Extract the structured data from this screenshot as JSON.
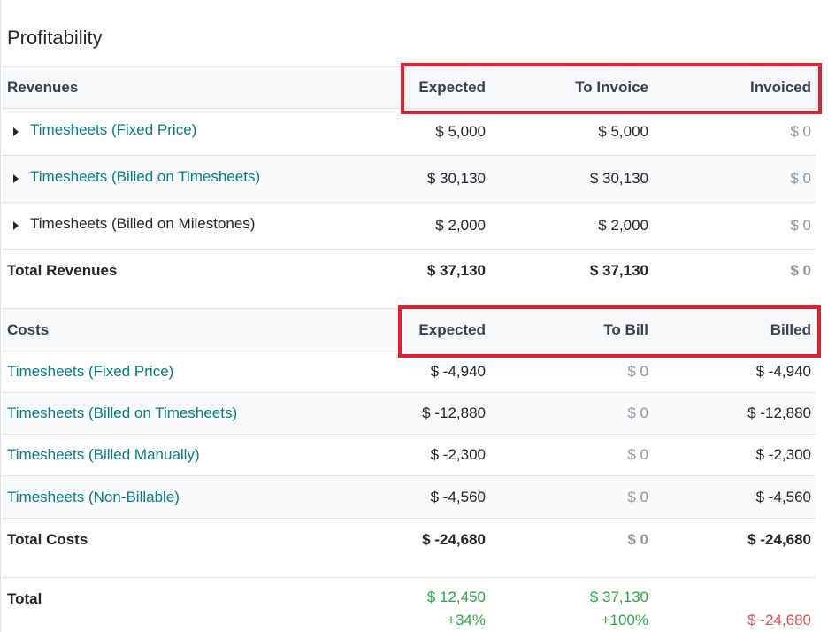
{
  "title": "Profitability",
  "revenues": {
    "header": {
      "label": "Revenues",
      "col1": "Expected",
      "col2": "To Invoice",
      "col3": "Invoiced"
    },
    "rows": [
      {
        "label": "Timesheets (Fixed Price)",
        "expected": "$ 5,000",
        "to_invoice": "$ 5,000",
        "invoiced": "$ 0"
      },
      {
        "label": "Timesheets (Billed on Timesheets)",
        "expected": "$ 30,130",
        "to_invoice": "$ 30,130",
        "invoiced": "$ 0"
      },
      {
        "label": "Timesheets (Billed on Milestones)",
        "expected": "$ 2,000",
        "to_invoice": "$ 2,000",
        "invoiced": "$ 0"
      }
    ],
    "total": {
      "label": "Total Revenues",
      "expected": "$ 37,130",
      "to_invoice": "$ 37,130",
      "invoiced": "$ 0"
    }
  },
  "costs": {
    "header": {
      "label": "Costs",
      "col1": "Expected",
      "col2": "To Bill",
      "col3": "Billed"
    },
    "rows": [
      {
        "label": "Timesheets (Fixed Price)",
        "expected": "$ -4,940",
        "to_bill": "$ 0",
        "billed": "$ -4,940"
      },
      {
        "label": "Timesheets (Billed on Timesheets)",
        "expected": "$ -12,880",
        "to_bill": "$ 0",
        "billed": "$ -12,880"
      },
      {
        "label": "Timesheets (Billed Manually)",
        "expected": "$ -2,300",
        "to_bill": "$ 0",
        "billed": "$ -2,300"
      },
      {
        "label": "Timesheets (Non-Billable)",
        "expected": "$ -4,560",
        "to_bill": "$ 0",
        "billed": "$ -4,560"
      }
    ],
    "total": {
      "label": "Total Costs",
      "expected": "$ -24,680",
      "to_bill": "$ 0",
      "billed": "$ -24,680"
    }
  },
  "grand_total": {
    "label": "Total",
    "expected": "$ 12,450",
    "expected_pct": "+34%",
    "to_invoice": "$ 37,130",
    "to_invoice_pct": "+100%",
    "invoiced": "$ -24,680"
  },
  "colors": {
    "link": "#017e84",
    "positive": "#28a745",
    "negative": "#d9534f",
    "highlight": "#e0202e"
  },
  "icons": {
    "expand": "caret-right-icon"
  }
}
